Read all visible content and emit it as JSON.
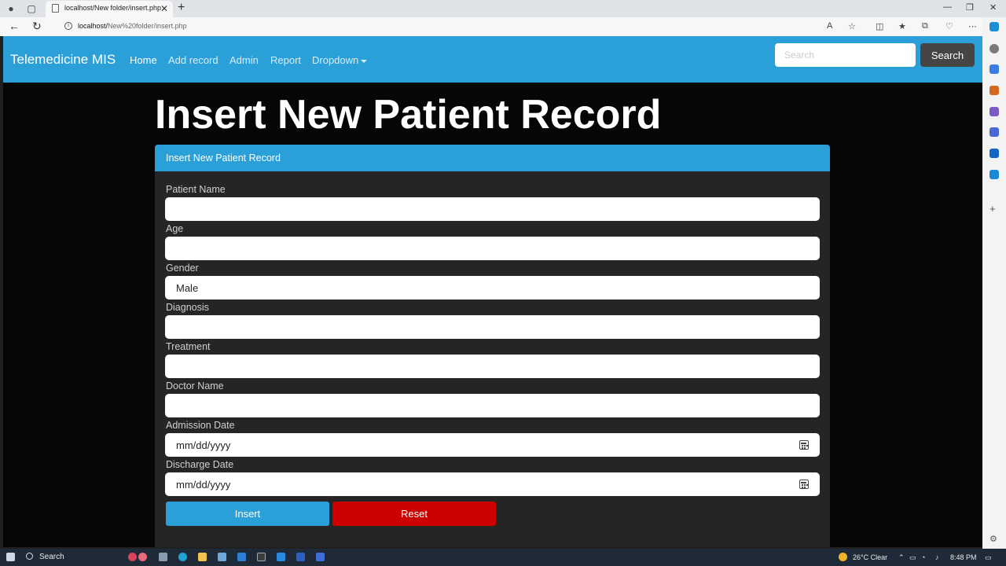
{
  "browser": {
    "tab_title": "localhost/New folder/insert.php",
    "new_tab_symbol": "+",
    "url_host": "localhost/",
    "url_path": "New%20folder/insert.php"
  },
  "navbar": {
    "brand": "Telemedicine MIS",
    "links": [
      "Home",
      "Add record",
      "Admin",
      "Report",
      "Dropdown"
    ],
    "search_placeholder": "Search",
    "search_button": "Search"
  },
  "page": {
    "heading": "Insert New Patient Record",
    "card_title": "Insert New Patient Record"
  },
  "form": {
    "fields": [
      {
        "label": "Patient Name",
        "value": ""
      },
      {
        "label": "Age",
        "value": ""
      },
      {
        "label": "Gender",
        "value": "Male"
      },
      {
        "label": "Diagnosis",
        "value": ""
      },
      {
        "label": "Treatment",
        "value": ""
      },
      {
        "label": "Doctor Name",
        "value": ""
      },
      {
        "label": "Admission Date",
        "value": "mm/dd/yyyy"
      },
      {
        "label": "Discharge Date",
        "value": "mm/dd/yyyy"
      }
    ],
    "insert_button": "Insert",
    "reset_button": "Reset"
  },
  "taskbar": {
    "search_label": "Search",
    "weather": "26°C Clear",
    "time": "8:48 PM"
  },
  "colors": {
    "primary": "#2b9fd8",
    "danger": "#cc0000",
    "card_bg": "#252525",
    "page_bg": "#060606"
  }
}
